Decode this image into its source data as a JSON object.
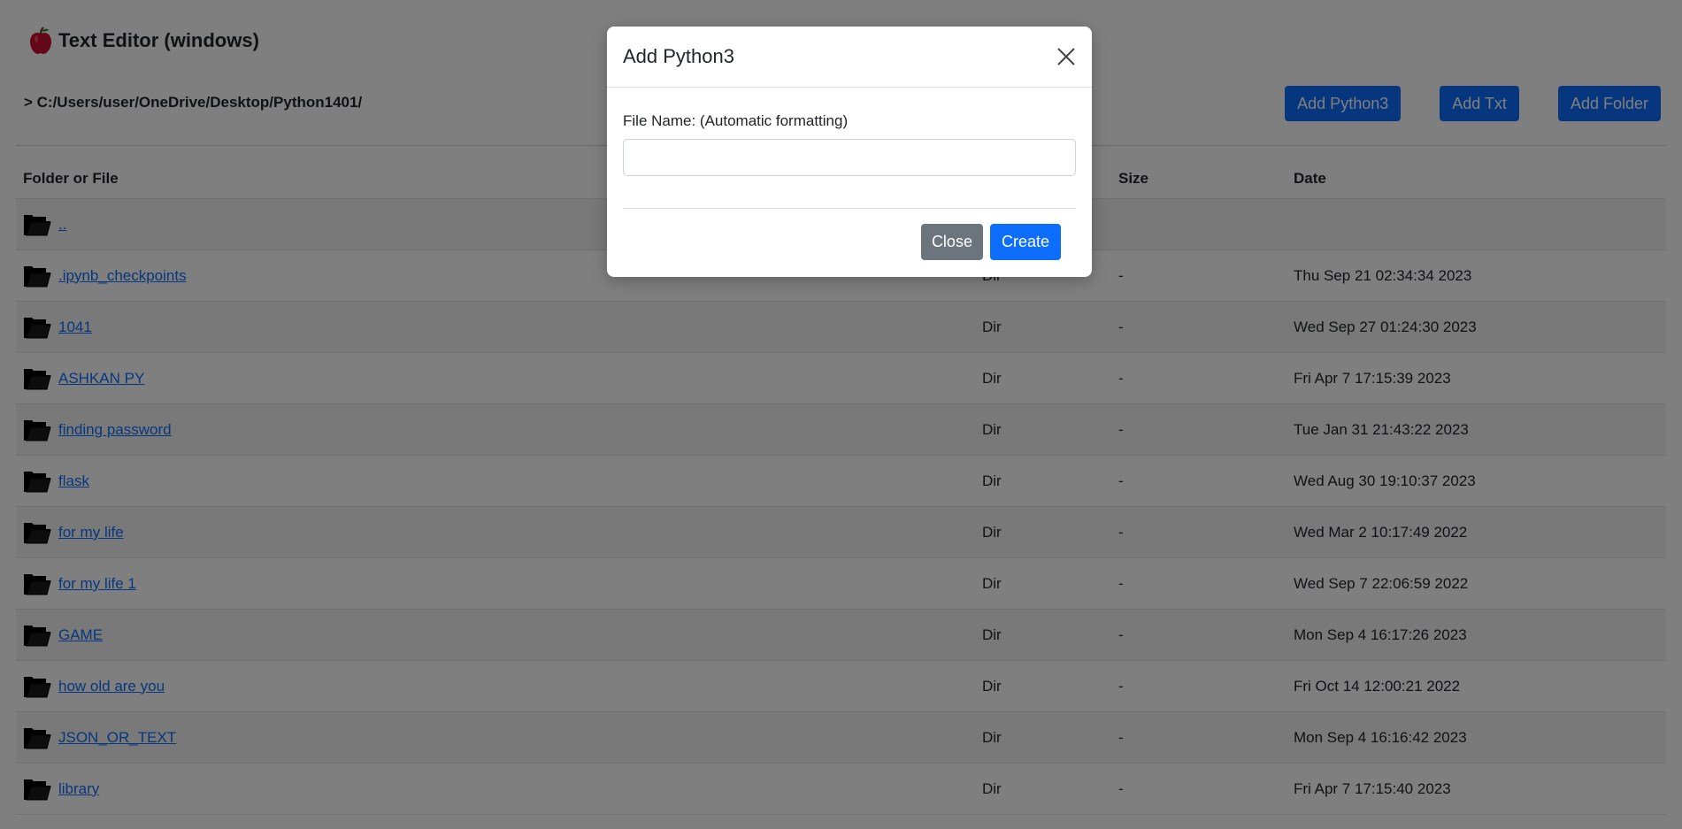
{
  "app": {
    "title": "Text Editor (windows)",
    "logo_icon": "apple-icon"
  },
  "path": "> C:/Users/user/OneDrive/Desktop/Python1401/",
  "toolbar": {
    "add_python_label": "Add Python3",
    "add_txt_label": "Add Txt",
    "add_folder_label": "Add Folder"
  },
  "table": {
    "headers": {
      "name": "Folder or File",
      "type": "",
      "size": "Size",
      "date": "Date"
    },
    "rows": [
      {
        "name": "..",
        "type": "",
        "size": "",
        "date": ""
      },
      {
        "name": ".ipynb_checkpoints",
        "type": "Dir",
        "size": "-",
        "date": "Thu Sep 21 02:34:34 2023"
      },
      {
        "name": "1041",
        "type": "Dir",
        "size": "-",
        "date": "Wed Sep 27 01:24:30 2023"
      },
      {
        "name": "ASHKAN PY",
        "type": "Dir",
        "size": "-",
        "date": "Fri Apr 7 17:15:39 2023"
      },
      {
        "name": "finding password",
        "type": "Dir",
        "size": "-",
        "date": "Tue Jan 31 21:43:22 2023"
      },
      {
        "name": "flask",
        "type": "Dir",
        "size": "-",
        "date": "Wed Aug 30 19:10:37 2023"
      },
      {
        "name": "for my life",
        "type": "Dir",
        "size": "-",
        "date": "Wed Mar 2 10:17:49 2022"
      },
      {
        "name": "for my life 1",
        "type": "Dir",
        "size": "-",
        "date": "Wed Sep 7 22:06:59 2022"
      },
      {
        "name": "GAME",
        "type": "Dir",
        "size": "-",
        "date": "Mon Sep 4 16:17:26 2023"
      },
      {
        "name": "how old are you",
        "type": "Dir",
        "size": "-",
        "date": "Fri Oct 14 12:00:21 2022"
      },
      {
        "name": "JSON_OR_TEXT",
        "type": "Dir",
        "size": "-",
        "date": "Mon Sep 4 16:16:42 2023"
      },
      {
        "name": "library",
        "type": "Dir",
        "size": "-",
        "date": "Fri Apr 7 17:15:40 2023"
      }
    ]
  },
  "modal": {
    "title": "Add Python3",
    "field_label": "File Name: (Automatic formatting)",
    "field_value": "",
    "field_placeholder": "",
    "close_label": "Close",
    "create_label": "Create"
  },
  "icons": {
    "folder": "folder-icon",
    "close": "close-icon"
  },
  "colors": {
    "primary": "#0d6efd",
    "secondary": "#6c757d",
    "overlay": "rgba(0,0,0,0.5)"
  }
}
